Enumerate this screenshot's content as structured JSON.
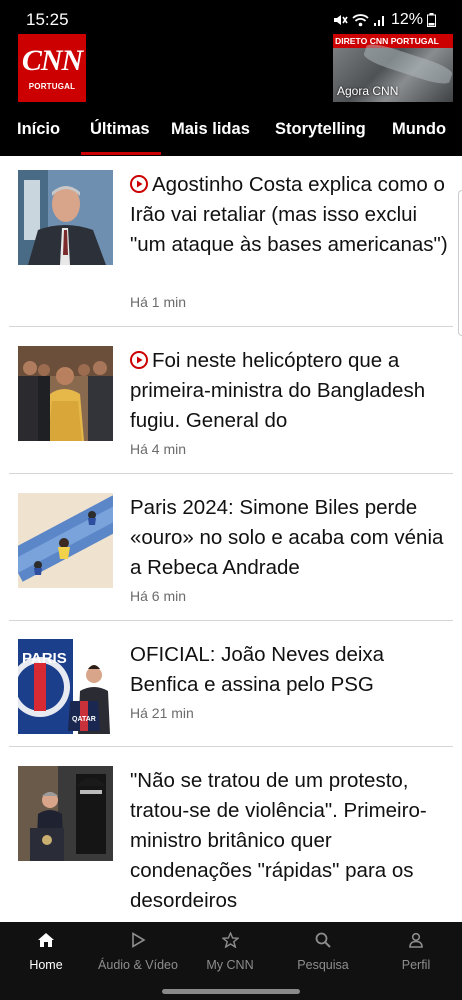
{
  "status_bar": {
    "time": "15:25",
    "battery": "12%"
  },
  "header": {
    "logo_text": "CNN",
    "logo_sub": "PORTUGAL",
    "live_banner": "DIRETO CNN PORTUGAL",
    "live_caption": "Agora CNN"
  },
  "tabs": [
    "Início",
    "Últimas",
    "Mais lidas",
    "Storytelling",
    "Mundo"
  ],
  "active_tab": "Últimas",
  "articles": [
    {
      "headline": "Agostinho Costa explica como o Irão vai retaliar (mas isso exclui \"um ataque às bases americanas\")",
      "time": "Há 1 min",
      "video": true
    },
    {
      "headline": "Foi neste helicóptero que a primeira-ministra do Bangladesh fugiu. General do",
      "time": "Há 4 min",
      "video": true
    },
    {
      "headline": "Paris 2024: Simone Biles perde «ouro» no solo e acaba com vénia a Rebeca Andrade",
      "time": "Há 6 min",
      "video": false
    },
    {
      "headline": "OFICIAL: João Neves deixa Benfica e assina pelo PSG",
      "time": "Há 21 min",
      "video": false
    },
    {
      "headline": "\"Não se tratou de um protesto, tratou-se de violência\". Primeiro-ministro britânico quer condenações \"rápidas\" para os desordeiros",
      "time": "",
      "video": false
    }
  ],
  "thumb_texts": {
    "psg_crest": "PARIS",
    "jersey": "QATAR"
  },
  "bottom_nav": [
    {
      "label": "Home",
      "icon": "home-icon",
      "active": true
    },
    {
      "label": "Áudio & Vídeo",
      "icon": "play-icon",
      "active": false
    },
    {
      "label": "My CNN",
      "icon": "star-icon",
      "active": false
    },
    {
      "label": "Pesquisa",
      "icon": "search-icon",
      "active": false
    },
    {
      "label": "Perfil",
      "icon": "person-icon",
      "active": false
    }
  ],
  "colors": {
    "brand": "#cc0000",
    "background": "#000000",
    "text": "#111111",
    "muted": "#6b6b6b"
  }
}
